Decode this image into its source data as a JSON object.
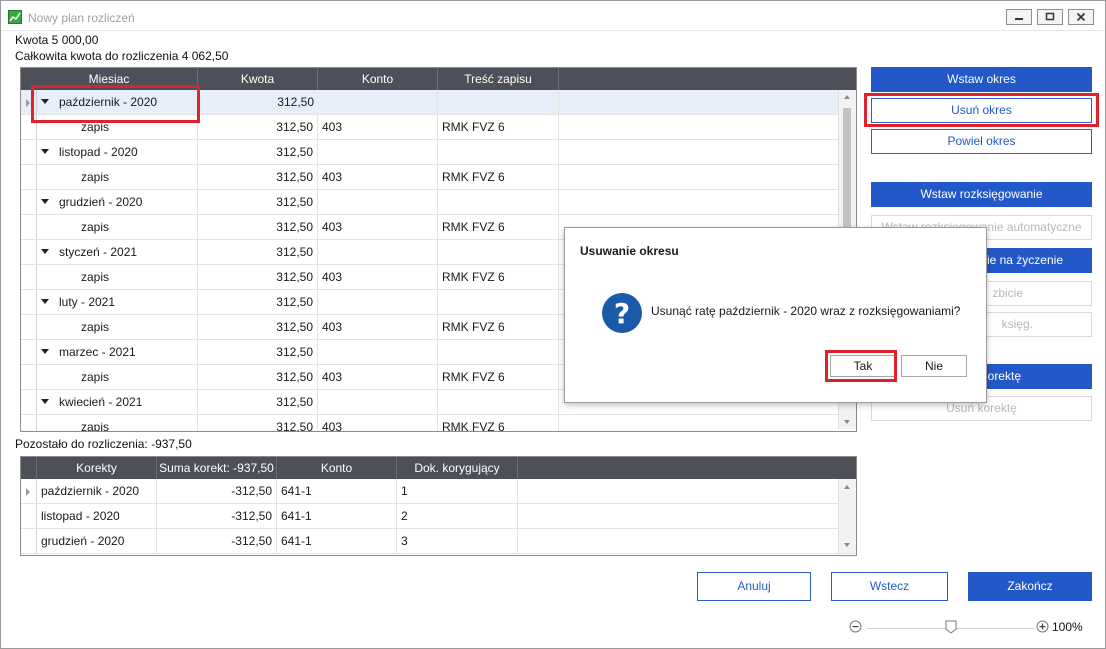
{
  "window": {
    "title": "Nowy plan rozliczeń"
  },
  "summary": {
    "amount": "Kwota 5 000,00",
    "total_to_settle": "Całkowita kwota do rozliczenia 4 062,50",
    "remaining": "Pozostało do rozliczenia: -937,50"
  },
  "periods_grid": {
    "columns": [
      "Miesiac",
      "Kwota",
      "Konto",
      "Treść zapisu"
    ],
    "rows": [
      {
        "kind": "group",
        "c0": "październik - 2020",
        "c1": "312,50",
        "c2": "",
        "c3": ""
      },
      {
        "kind": "detail",
        "c0": "zapis",
        "c1": "312,50",
        "c2": "403",
        "c3": "RMK FVZ 6"
      },
      {
        "kind": "group",
        "c0": "listopad - 2020",
        "c1": "312,50",
        "c2": "",
        "c3": ""
      },
      {
        "kind": "detail",
        "c0": "zapis",
        "c1": "312,50",
        "c2": "403",
        "c3": "RMK FVZ 6"
      },
      {
        "kind": "group",
        "c0": "grudzień - 2020",
        "c1": "312,50",
        "c2": "",
        "c3": ""
      },
      {
        "kind": "detail",
        "c0": "zapis",
        "c1": "312,50",
        "c2": "403",
        "c3": "RMK FVZ 6"
      },
      {
        "kind": "group",
        "c0": "styczeń - 2021",
        "c1": "312,50",
        "c2": "",
        "c3": ""
      },
      {
        "kind": "detail",
        "c0": "zapis",
        "c1": "312,50",
        "c2": "403",
        "c3": "RMK FVZ 6"
      },
      {
        "kind": "group",
        "c0": "luty - 2021",
        "c1": "312,50",
        "c2": "",
        "c3": ""
      },
      {
        "kind": "detail",
        "c0": "zapis",
        "c1": "312,50",
        "c2": "403",
        "c3": "RMK FVZ 6"
      },
      {
        "kind": "group",
        "c0": "marzec - 2021",
        "c1": "312,50",
        "c2": "",
        "c3": ""
      },
      {
        "kind": "detail",
        "c0": "zapis",
        "c1": "312,50",
        "c2": "403",
        "c3": "RMK FVZ 6"
      },
      {
        "kind": "group",
        "c0": "kwiecień - 2021",
        "c1": "312,50",
        "c2": "",
        "c3": ""
      },
      {
        "kind": "detail",
        "c0": "zapis",
        "c1": "312,50",
        "c2": "403",
        "c3": "RMK FVZ 6"
      }
    ]
  },
  "corrections_grid": {
    "columns": [
      "Korekty",
      "Suma korekt: -937,50",
      "Konto",
      "Dok. korygujący"
    ],
    "rows": [
      {
        "c0": "październik - 2020",
        "c1": "-312,50",
        "c2": "641-1",
        "c3": "1"
      },
      {
        "c0": "listopad - 2020",
        "c1": "-312,50",
        "c2": "641-1",
        "c3": "2"
      },
      {
        "c0": "grudzień - 2020",
        "c1": "-312,50",
        "c2": "641-1",
        "c3": "3"
      }
    ]
  },
  "actions": {
    "insert_period": "Wstaw okres",
    "delete_period": "Usuń okres",
    "repeat_period": "Powiel okres",
    "insert_posting": "Wstaw rozksięgowanie",
    "posting_auto": "Wstaw rozksięgowanie automatyczne",
    "posting_on_demand": "ie na życzenie",
    "split": "zbicie",
    "unpost": "księg.",
    "correction": "orektę",
    "delete_correction": "Usuń korektę"
  },
  "dialog": {
    "title": "Usuwanie okresu",
    "message": "Usunąć ratę październik - 2020 wraz z rozksięgowaniami?",
    "yes": "Tak",
    "no": "Nie"
  },
  "footer": {
    "cancel": "Anuluj",
    "back": "Wstecz",
    "finish": "Zakończ",
    "zoom_level": "100%",
    "zoom_value": 0.5
  },
  "colors": {
    "accent": "#2358c8",
    "highlight": "#e0202a",
    "header": "#4d5058"
  }
}
